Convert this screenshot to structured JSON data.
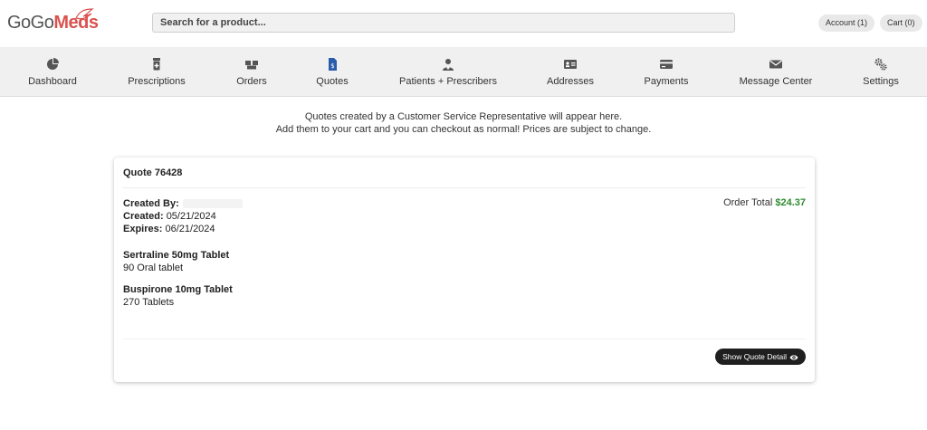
{
  "header": {
    "logo_part1": "GoGo",
    "logo_part2": "Meds",
    "search_placeholder": "Search for a product...",
    "account_label": "Account (1)",
    "cart_label": "Cart (0)"
  },
  "nav": {
    "items": [
      {
        "label": "Dashboard",
        "icon": "pie-chart-icon"
      },
      {
        "label": "Prescriptions",
        "icon": "prescription-bottle-icon"
      },
      {
        "label": "Orders",
        "icon": "boxes-icon"
      },
      {
        "label": "Quotes",
        "icon": "file-dollar-icon"
      },
      {
        "label": "Patients + Prescribers",
        "icon": "user-doctor-icon"
      },
      {
        "label": "Addresses",
        "icon": "address-card-icon"
      },
      {
        "label": "Payments",
        "icon": "credit-card-icon"
      },
      {
        "label": "Message Center",
        "icon": "envelope-icon"
      },
      {
        "label": "Settings",
        "icon": "gears-icon"
      }
    ],
    "active": "Quotes",
    "active_color": "#2b5cab"
  },
  "intro": {
    "line1": "Quotes created by a Customer Service Representative will appear here.",
    "line2": "Add them to your cart and you can checkout as normal! Prices are subject to change."
  },
  "quote": {
    "title": "Quote 76428",
    "created_by_label": "Created By:",
    "created_label": "Created:",
    "created_value": "05/21/2024",
    "expires_label": "Expires:",
    "expires_value": "06/21/2024",
    "total_label": "Order Total",
    "total_value": "$24.37",
    "total_color": "#2e8b2e",
    "items": [
      {
        "name": "Sertraline 50mg Tablet",
        "qty": "90 Oral tablet"
      },
      {
        "name": "Buspirone 10mg Tablet",
        "qty": "270 Tablets"
      }
    ],
    "detail_button": "Show Quote Detail"
  }
}
